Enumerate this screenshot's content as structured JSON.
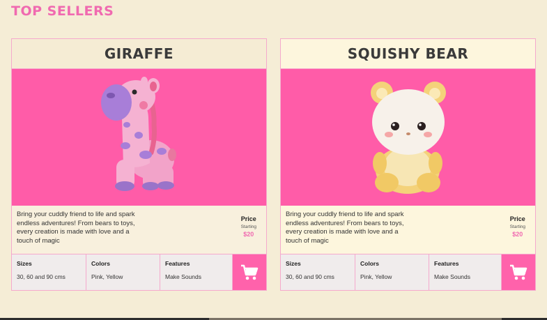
{
  "page": {
    "title": "TOP SELLERS"
  },
  "colors": {
    "accent": "#f06ab0",
    "image_bg": "#ff5ca8",
    "background": "#f5edd6"
  },
  "products": [
    {
      "name": "GIRAFFE",
      "image_icon": "giraffe-plush-image",
      "description": "Bring your cuddly friend to life and spark endless adventures! From bears to toys, every creation is made with love and a touch of magic",
      "price_label": "Price",
      "price_starting": "Starting",
      "price_value": "$20",
      "specs": [
        {
          "name": "Sizes",
          "value": "30, 60 and 90 cms"
        },
        {
          "name": "Colors",
          "value": "Pink, Yellow"
        },
        {
          "name": "Features",
          "value": "Make Sounds"
        }
      ],
      "cart_icon": "cart-icon"
    },
    {
      "name": "SQUISHY BEAR",
      "image_icon": "bear-plush-image",
      "description": "Bring your cuddly friend to life and spark endless adventures! From bears to toys, every creation is made with love and a touch of magic",
      "price_label": "Price",
      "price_starting": "Starting",
      "price_value": "$20",
      "specs": [
        {
          "name": "Sizes",
          "value": "30, 60 and 90 cms"
        },
        {
          "name": "Colors",
          "value": "Pink, Yellow"
        },
        {
          "name": "Features",
          "value": "Make Sounds"
        }
      ],
      "cart_icon": "cart-icon"
    }
  ]
}
